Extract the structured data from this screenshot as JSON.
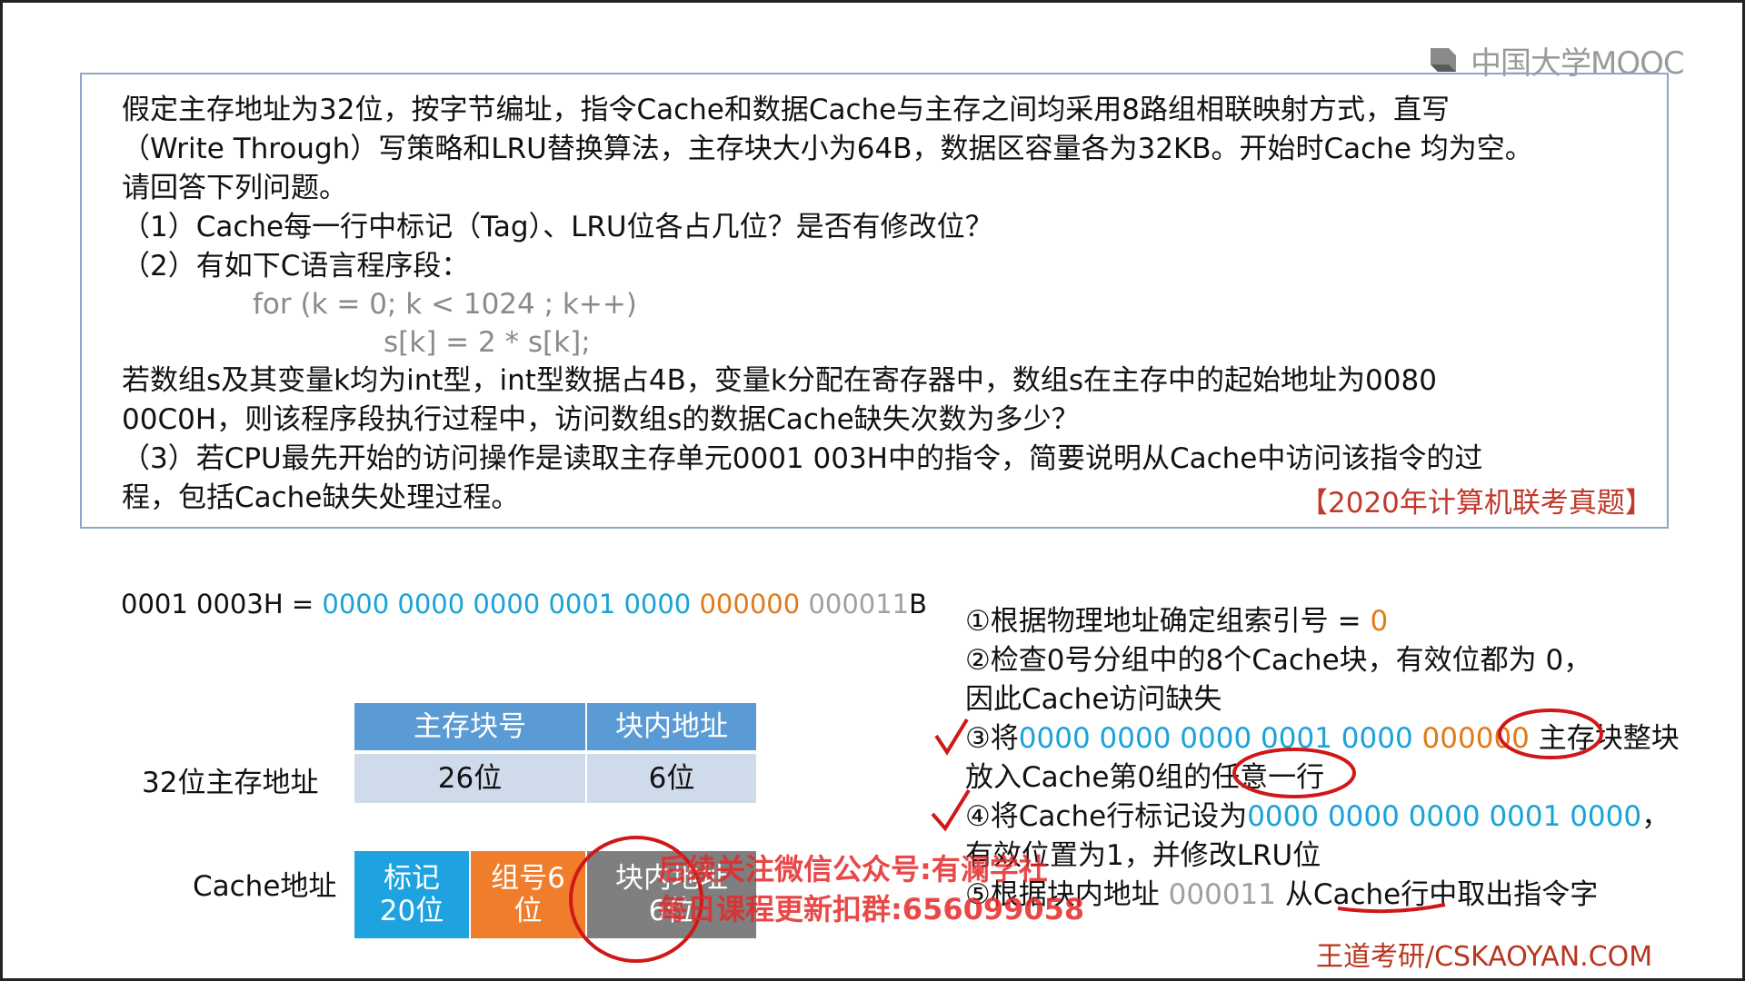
{
  "logo": {
    "text": "中国大学MOOC"
  },
  "question": {
    "lines": [
      "假定主存地址为32位，按字节编址，指令Cache和数据Cache与主存之间均采用8路组相联映射方式，直写",
      "（Write Through）写策略和LRU替换算法，主存块大小为64B，数据区容量各为32KB。开始时Cache 均为空。",
      "请回答下列问题。",
      "（1）Cache每一行中标记（Tag）、LRU位各占几位？是否有修改位？",
      "（2）有如下C语言程序段：",
      "for (k = 0; k < 1024 ; k++)",
      "s[k] = 2 * s[k];",
      "若数组s及其变量k均为int型，int型数据占4B，变量k分配在寄存器中，数组s在主存中的起始地址为0080",
      "00C0H，则该程序段执行过程中，访问数组s的数据Cache缺失次数为多少？",
      "（3）若CPU最先开始的访问操作是读取主存单元0001 003H中的指令，简要说明从Cache中访问该指令的过",
      "程，包括Cache缺失处理过程。"
    ],
    "source": "【2020年计算机联考真题】"
  },
  "address": {
    "prefix": "0001 0003H = ",
    "tag": "0000 0000 0000 0001 0000",
    "group": "000000",
    "offset": "000011",
    "suffix": "B"
  },
  "main_addr": {
    "label": "32位主存地址",
    "h1": "主存块号",
    "h2": "块内地址",
    "v1": "26位",
    "v2": "6位"
  },
  "cache_addr": {
    "label": "Cache地址",
    "tag": "标记\n20位",
    "group": "组号6\n位",
    "offset": "块内地址\n6位"
  },
  "steps": {
    "s1_text": "①根据物理地址确定组索引号 = ",
    "s1_val": "0",
    "s2a": "②检查0号分组中的8个Cache块，有效位都为 0，",
    "s2b": "因此Cache访问缺失",
    "s3_pre": "③将",
    "s3_tag": "0000 0000 0000 0001 0000",
    "s3_grp": "000000",
    "s3_post": "主存块整块",
    "s3b": "放入Cache第0组的任意一行",
    "s4_pre": "④将Cache行标记设为",
    "s4_tag": "0000 0000 0000 0001 0000",
    "s4_post": "，",
    "s4b": "有效位置为1，并修改LRU位",
    "s5_pre": "⑤根据块内地址 ",
    "s5_off": "000011",
    "s5_post": " 从Cache行中取出指令字"
  },
  "watermark": {
    "line1": "后续关注微信公众号:有澜学社",
    "line2": "每日课程更新扣群:656099058"
  },
  "footer": "王道考研/CSKAOYAN.COM"
}
